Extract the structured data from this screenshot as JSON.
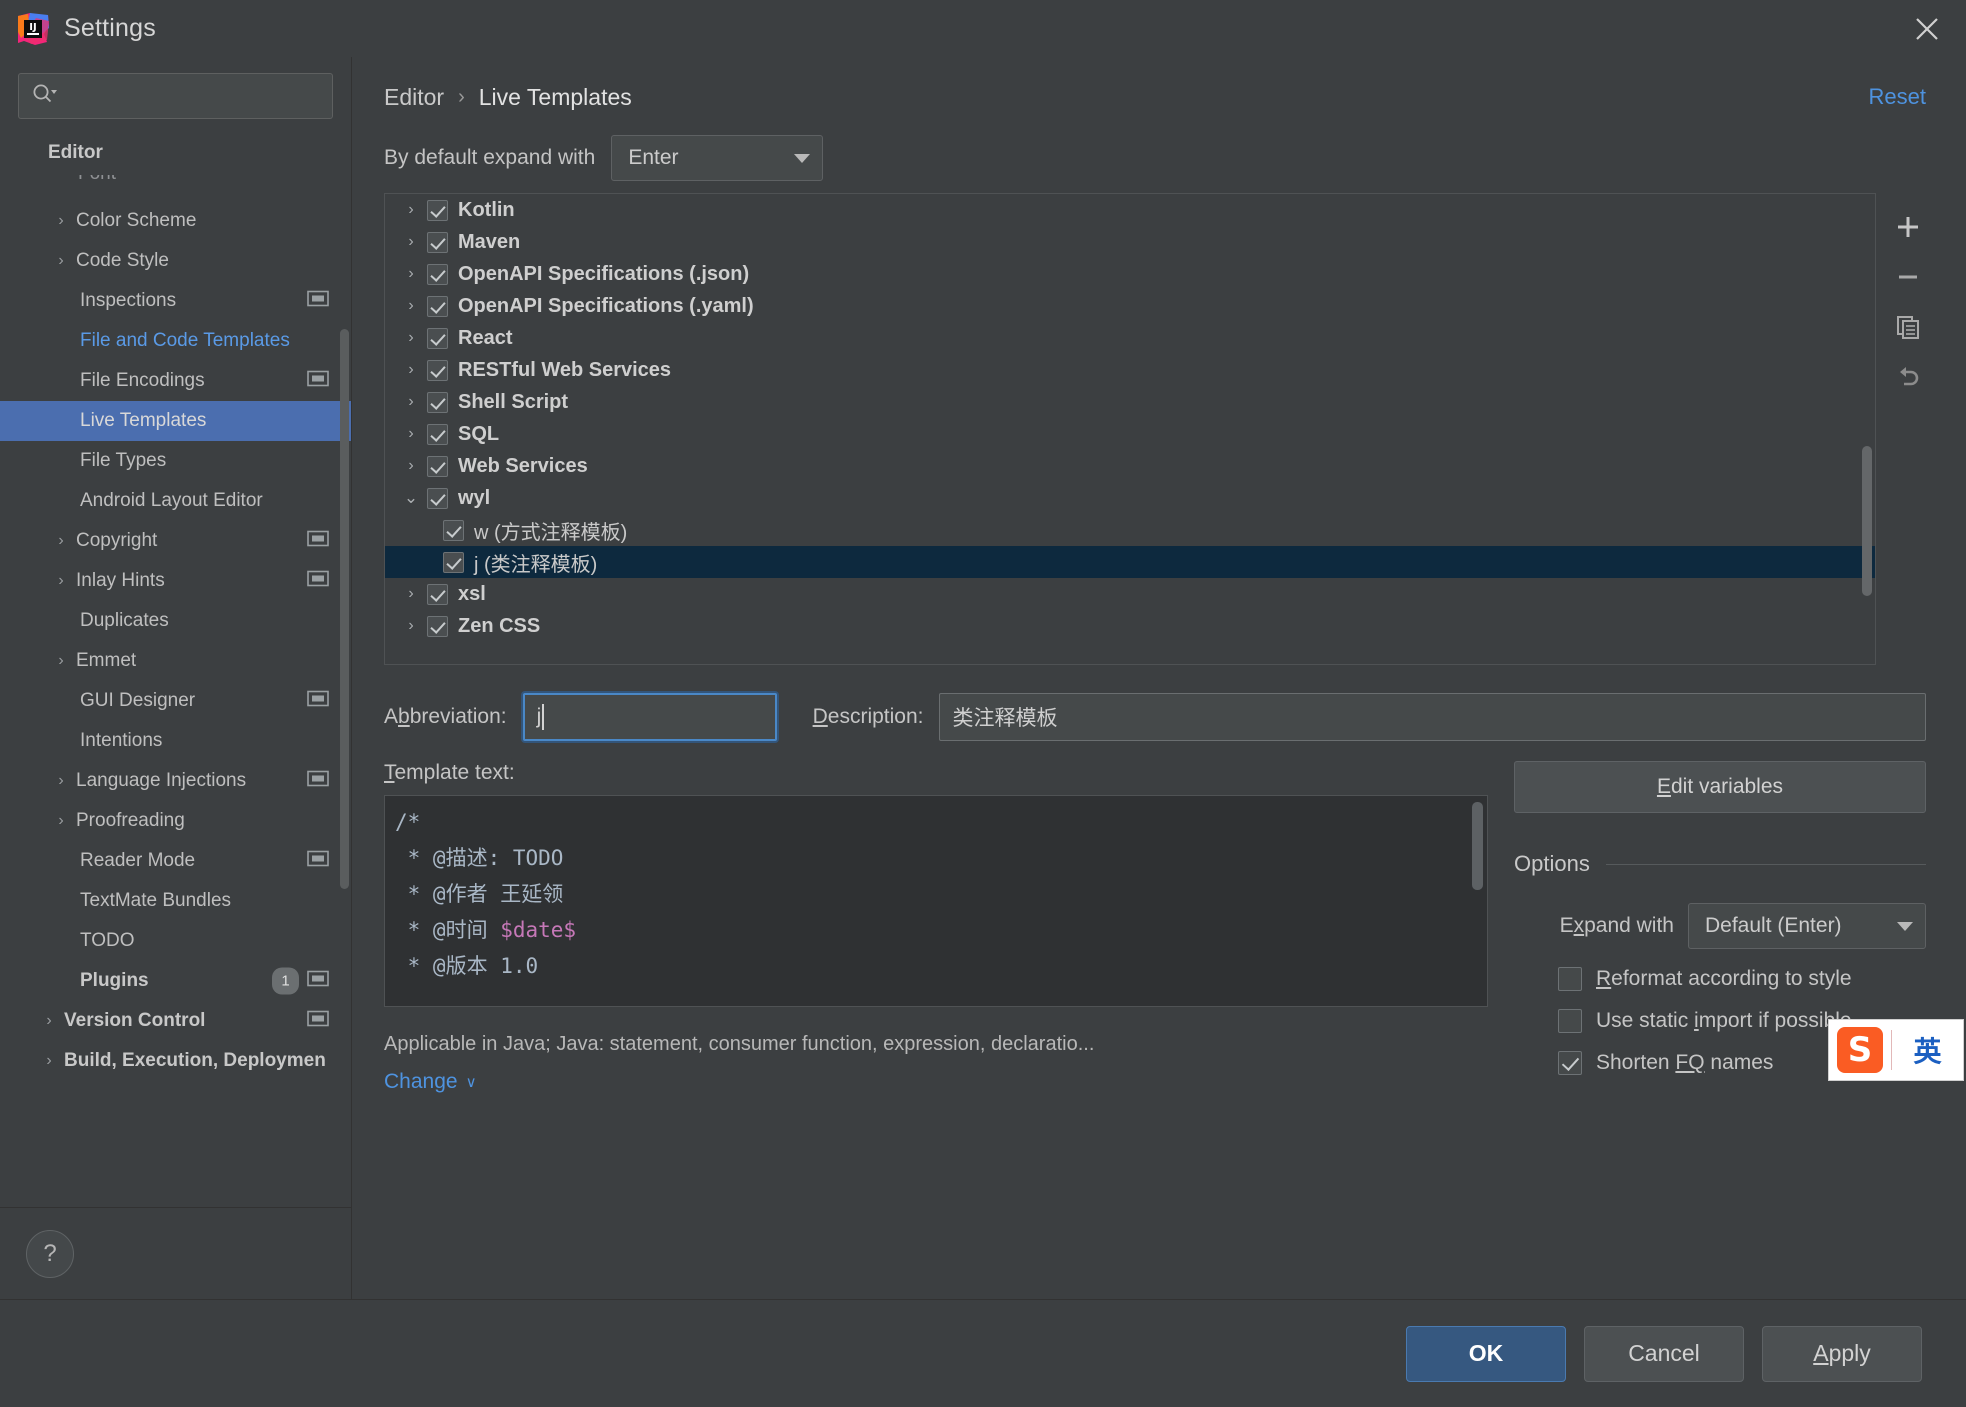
{
  "window": {
    "title": "Settings",
    "logo_icon": "intellij-idea-logo",
    "close_icon": "close-icon"
  },
  "sidebar": {
    "search": {
      "placeholder": "",
      "value": "",
      "icon": "search-icon"
    },
    "items": [
      {
        "label": "Editor",
        "bold": true,
        "twisty": "",
        "indent": 0,
        "proj": false,
        "state": "header"
      },
      {
        "label": "Font",
        "bold": false,
        "twisty": "",
        "indent": 1,
        "proj": false,
        "state": "clipped"
      },
      {
        "label": "Color Scheme",
        "bold": false,
        "twisty": ">",
        "indent": 0,
        "proj": false,
        "state": "normal"
      },
      {
        "label": "Code Style",
        "bold": false,
        "twisty": ">",
        "indent": 0,
        "proj": false,
        "state": "normal"
      },
      {
        "label": "Inspections",
        "bold": false,
        "twisty": "",
        "indent": 1,
        "proj": true,
        "state": "normal"
      },
      {
        "label": "File and Code Templates",
        "bold": false,
        "twisty": "",
        "indent": 1,
        "proj": false,
        "state": "link"
      },
      {
        "label": "File Encodings",
        "bold": false,
        "twisty": "",
        "indent": 1,
        "proj": true,
        "state": "normal"
      },
      {
        "label": "Live Templates",
        "bold": false,
        "twisty": "",
        "indent": 1,
        "proj": false,
        "state": "selected"
      },
      {
        "label": "File Types",
        "bold": false,
        "twisty": "",
        "indent": 1,
        "proj": false,
        "state": "normal"
      },
      {
        "label": "Android Layout Editor",
        "bold": false,
        "twisty": "",
        "indent": 1,
        "proj": false,
        "state": "normal"
      },
      {
        "label": "Copyright",
        "bold": false,
        "twisty": ">",
        "indent": 0,
        "proj": true,
        "state": "normal"
      },
      {
        "label": "Inlay Hints",
        "bold": false,
        "twisty": ">",
        "indent": 0,
        "proj": true,
        "state": "normal"
      },
      {
        "label": "Duplicates",
        "bold": false,
        "twisty": "",
        "indent": 1,
        "proj": false,
        "state": "normal"
      },
      {
        "label": "Emmet",
        "bold": false,
        "twisty": ">",
        "indent": 0,
        "proj": false,
        "state": "normal"
      },
      {
        "label": "GUI Designer",
        "bold": false,
        "twisty": "",
        "indent": 1,
        "proj": true,
        "state": "normal"
      },
      {
        "label": "Intentions",
        "bold": false,
        "twisty": "",
        "indent": 1,
        "proj": false,
        "state": "normal"
      },
      {
        "label": "Language Injections",
        "bold": false,
        "twisty": ">",
        "indent": 0,
        "proj": true,
        "state": "normal"
      },
      {
        "label": "Proofreading",
        "bold": false,
        "twisty": ">",
        "indent": 0,
        "proj": false,
        "state": "normal"
      },
      {
        "label": "Reader Mode",
        "bold": false,
        "twisty": "",
        "indent": 1,
        "proj": true,
        "state": "normal"
      },
      {
        "label": "TextMate Bundles",
        "bold": false,
        "twisty": "",
        "indent": 1,
        "proj": false,
        "state": "normal"
      },
      {
        "label": "TODO",
        "bold": false,
        "twisty": "",
        "indent": 1,
        "proj": false,
        "state": "normal"
      },
      {
        "label": "Plugins",
        "bold": true,
        "twisty": "",
        "indent": 1,
        "proj": true,
        "state": "normal",
        "badge": "1"
      },
      {
        "label": "Version Control",
        "bold": true,
        "twisty": ">",
        "indent": 0,
        "proj": true,
        "state": "normal"
      },
      {
        "label": "Build, Execution, Deploymen",
        "bold": true,
        "twisty": ">",
        "indent": 0,
        "proj": false,
        "state": "normal"
      }
    ],
    "help_label": "?",
    "help_icon": "help-icon"
  },
  "header": {
    "breadcrumb_root": "Editor",
    "breadcrumb_sep": "›",
    "breadcrumb_leaf": "Live Templates",
    "reset_label": "Reset"
  },
  "expand_with": {
    "label": "By default expand with",
    "value": "Enter"
  },
  "tree": {
    "rows": [
      {
        "label": "Kotlin",
        "arrow": ">",
        "leaf": false,
        "checked": true,
        "selected": false
      },
      {
        "label": "Maven",
        "arrow": ">",
        "leaf": false,
        "checked": true,
        "selected": false
      },
      {
        "label": "OpenAPI Specifications (.json)",
        "arrow": ">",
        "leaf": false,
        "checked": true,
        "selected": false
      },
      {
        "label": "OpenAPI Specifications (.yaml)",
        "arrow": ">",
        "leaf": false,
        "checked": true,
        "selected": false
      },
      {
        "label": "React",
        "arrow": ">",
        "leaf": false,
        "checked": true,
        "selected": false
      },
      {
        "label": "RESTful Web Services",
        "arrow": ">",
        "leaf": false,
        "checked": true,
        "selected": false
      },
      {
        "label": "Shell Script",
        "arrow": ">",
        "leaf": false,
        "checked": true,
        "selected": false
      },
      {
        "label": "SQL",
        "arrow": ">",
        "leaf": false,
        "checked": true,
        "selected": false
      },
      {
        "label": "Web Services",
        "arrow": ">",
        "leaf": false,
        "checked": true,
        "selected": false
      },
      {
        "label": "wyl",
        "arrow": "v",
        "leaf": false,
        "checked": true,
        "selected": false
      },
      {
        "label": "w (方式注释模板)",
        "arrow": "",
        "leaf": true,
        "checked": true,
        "selected": false
      },
      {
        "label": "j (类注释模板)",
        "arrow": "",
        "leaf": true,
        "checked": true,
        "selected": true
      },
      {
        "label": "xsl",
        "arrow": ">",
        "leaf": false,
        "checked": true,
        "selected": false
      },
      {
        "label": "Zen CSS",
        "arrow": ">",
        "leaf": false,
        "checked": true,
        "selected": false
      }
    ],
    "toolbar": [
      {
        "icon": "plus-icon",
        "title": "Add"
      },
      {
        "icon": "minus-icon",
        "title": "Remove"
      },
      {
        "icon": "copy-icon",
        "title": "Duplicate"
      },
      {
        "icon": "revert-icon",
        "title": "Revert"
      }
    ]
  },
  "fields": {
    "abbreviation_label": "Abbreviation:",
    "abbreviation_value": "j",
    "description_label": "Description:",
    "description_value": "类注释模板"
  },
  "template_text": {
    "label": "Template text:",
    "lines": [
      {
        "plain": "/*",
        "var": ""
      },
      {
        "plain": " * @描述: TODO",
        "var": ""
      },
      {
        "plain": " * @作者 王延领",
        "var": ""
      },
      {
        "plain": " * @时间 ",
        "var": "$date$"
      },
      {
        "plain": " * @版本 1.0",
        "var": ""
      }
    ]
  },
  "applicable": {
    "text": "Applicable in Java; Java: statement, consumer function, expression, declaratio...",
    "change_label": "Change",
    "change_caret": "∨"
  },
  "options": {
    "edit_variables_label": "Edit variables",
    "edit_variables_mnemonic": "E",
    "title": "Options",
    "expand_with_label": "Expand with",
    "expand_with_value": "Default (Enter)",
    "checkboxes": [
      {
        "label": "Reformat according to style",
        "checked": false
      },
      {
        "label": "Use static import if possible",
        "checked": false
      },
      {
        "label": "Shorten FQ names",
        "checked": true
      }
    ]
  },
  "ime": {
    "logo_letter": "S",
    "mode": "英",
    "icon": "sogou-ime-icon"
  },
  "footer": {
    "ok_label": "OK",
    "cancel_label": "Cancel",
    "apply_label": "Apply"
  },
  "colors": {
    "bg": "#3c3f41",
    "selection_blue": "#4b6eaf",
    "tree_selection": "#0d293e",
    "link_blue": "#4e93e0",
    "primary_button": "#365880"
  }
}
